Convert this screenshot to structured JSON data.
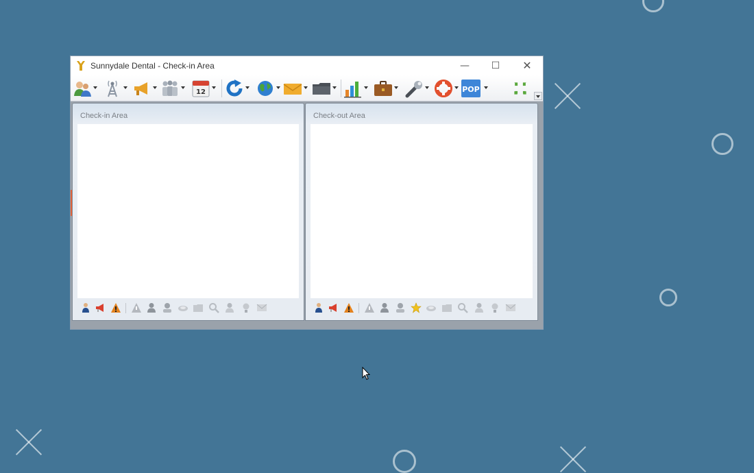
{
  "window": {
    "title": "Sunnydale Dental - Check-in Area",
    "controls": {
      "minimize": "—",
      "maximize": "☐",
      "close": "✕"
    }
  },
  "toolbar": {
    "items": [
      {
        "icon": "patients-icon",
        "has_dropdown": true
      },
      {
        "icon": "broadcast-tower-icon",
        "has_dropdown": true
      },
      {
        "icon": "megaphone-icon",
        "has_dropdown": true
      },
      {
        "icon": "people-group-icon",
        "has_dropdown": true
      },
      {
        "icon": "calendar-icon",
        "label": "12",
        "has_dropdown": true
      },
      {
        "icon": "refresh-icon",
        "has_dropdown": true
      },
      {
        "icon": "globe-icon",
        "has_dropdown": true
      },
      {
        "icon": "envelope-icon",
        "has_dropdown": true
      },
      {
        "icon": "folder-icon",
        "has_dropdown": true
      },
      {
        "icon": "bar-chart-icon",
        "has_dropdown": true
      },
      {
        "icon": "briefcase-icon",
        "has_dropdown": true
      },
      {
        "icon": "wrench-icon",
        "has_dropdown": true
      },
      {
        "icon": "lifebuoy-icon",
        "has_dropdown": true
      },
      {
        "icon": "pop-icon",
        "label": "POP",
        "has_dropdown": true
      },
      {
        "icon": "arrange-icon",
        "has_dropdown": false
      }
    ]
  },
  "panels": {
    "checkin": {
      "title": "Check-in Area"
    },
    "checkout": {
      "title": "Check-out Area"
    }
  },
  "colors": {
    "desktop": "#437596",
    "accent_orange": "#e2643a"
  }
}
